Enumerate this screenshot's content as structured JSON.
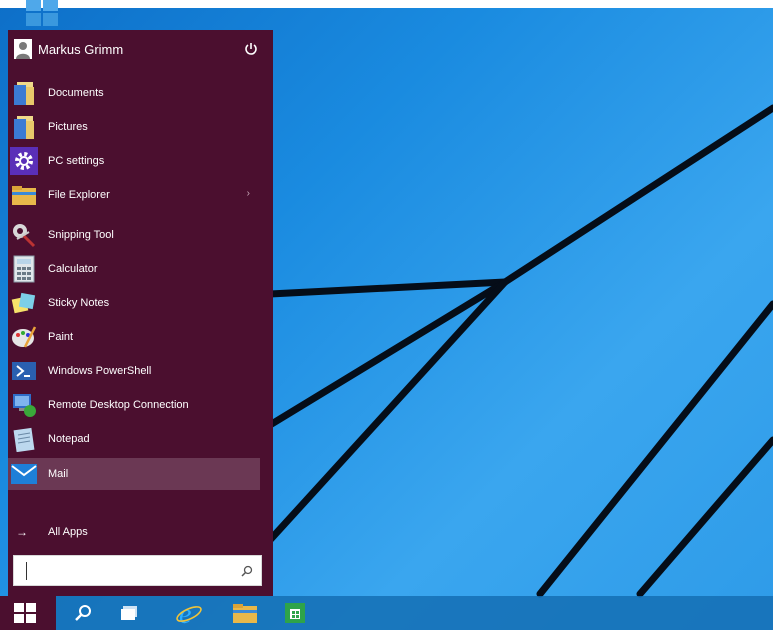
{
  "user": {
    "name": "Markus Grimm"
  },
  "menu": {
    "items": [
      {
        "label": "Documents",
        "icon": "documents-icon"
      },
      {
        "label": "Pictures",
        "icon": "pictures-icon"
      },
      {
        "label": "PC settings",
        "icon": "gear-icon"
      },
      {
        "label": "File Explorer",
        "icon": "folder-icon",
        "has_submenu": true
      },
      {
        "label": "Snipping Tool",
        "icon": "scissors-icon"
      },
      {
        "label": "Calculator",
        "icon": "calculator-icon"
      },
      {
        "label": "Sticky Notes",
        "icon": "sticky-notes-icon"
      },
      {
        "label": "Paint",
        "icon": "palette-icon"
      },
      {
        "label": "Windows PowerShell",
        "icon": "powershell-icon"
      },
      {
        "label": "Remote Desktop Connection",
        "icon": "remote-desktop-icon"
      },
      {
        "label": "Notepad",
        "icon": "notepad-icon"
      },
      {
        "label": "Mail",
        "icon": "mail-icon",
        "selected": true
      }
    ],
    "submenu_chevron": "›",
    "all_apps_arrow": "→",
    "all_apps_label": "All Apps"
  },
  "search": {
    "value": "",
    "placeholder": ""
  },
  "taskbar": {
    "items": [
      "windows-logo-icon",
      "search-icon",
      "task-view-icon",
      "internet-explorer-icon",
      "file-explorer-icon",
      "store-icon"
    ]
  },
  "colors": {
    "menu_bg": "#4b0f2f",
    "selected_bg": "#6b3854",
    "desktop": "#1a8be0"
  }
}
